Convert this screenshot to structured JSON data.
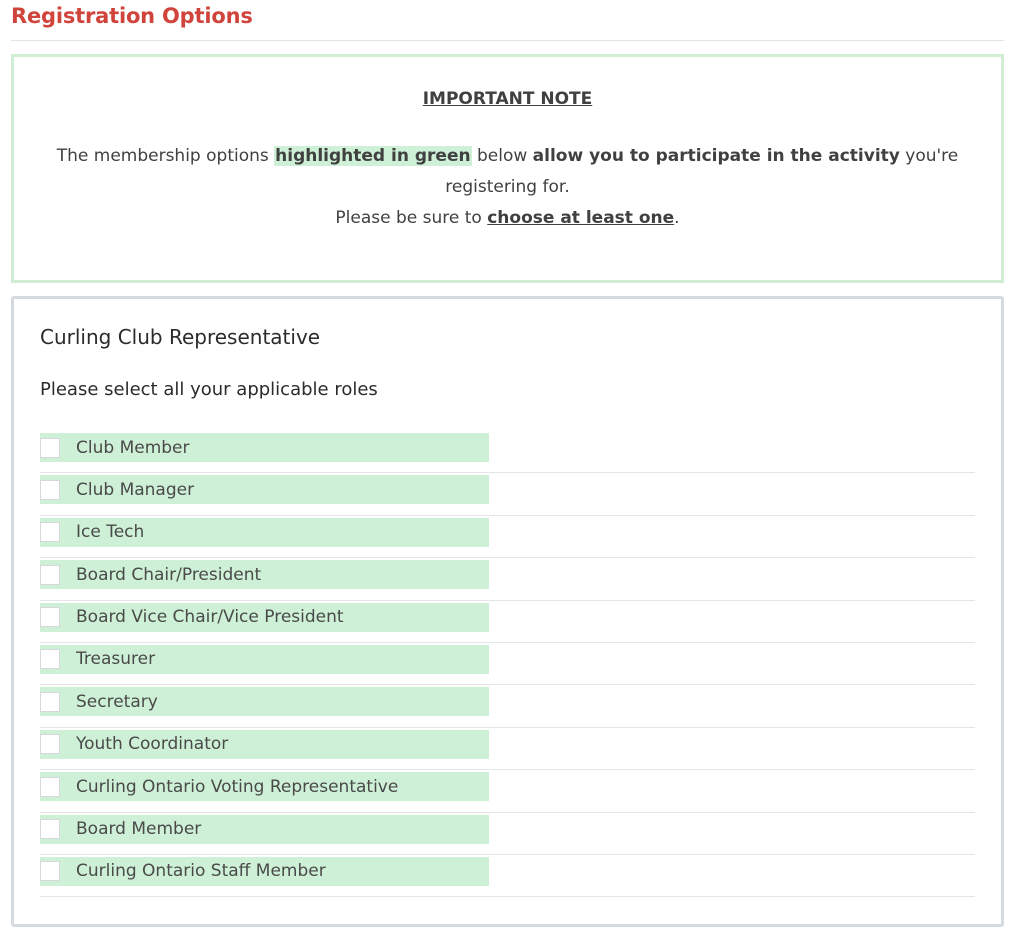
{
  "section": {
    "title": "Registration Options"
  },
  "note": {
    "heading": "IMPORTANT NOTE",
    "line1_pre": "The membership options ",
    "line1_highlight": "highlighted in green",
    "line1_mid": " below ",
    "line1_bold": "allow you to participate in the activity",
    "line1_post": " you're registering for.",
    "line2_pre": "Please be sure to ",
    "line2_link": "choose at least one",
    "line2_post": "."
  },
  "card": {
    "title": "Curling Club Representative",
    "subtitle": "Please select all your applicable roles",
    "roles": [
      {
        "label": "Club Member",
        "checked": false
      },
      {
        "label": "Club Manager",
        "checked": false
      },
      {
        "label": "Ice Tech",
        "checked": false
      },
      {
        "label": "Board Chair/President",
        "checked": false
      },
      {
        "label": "Board Vice Chair/Vice President",
        "checked": false
      },
      {
        "label": "Treasurer",
        "checked": false
      },
      {
        "label": "Secretary",
        "checked": false
      },
      {
        "label": "Youth Coordinator",
        "checked": false
      },
      {
        "label": "Curling Ontario Voting Representative",
        "checked": false
      },
      {
        "label": "Board Member",
        "checked": false
      },
      {
        "label": "Curling Ontario Staff Member",
        "checked": false
      }
    ]
  },
  "colors": {
    "title_red": "#d0443c",
    "highlight_green": "#cdf0d6",
    "note_border_green": "#cfeed3",
    "card_border_gray": "#d5dade"
  }
}
